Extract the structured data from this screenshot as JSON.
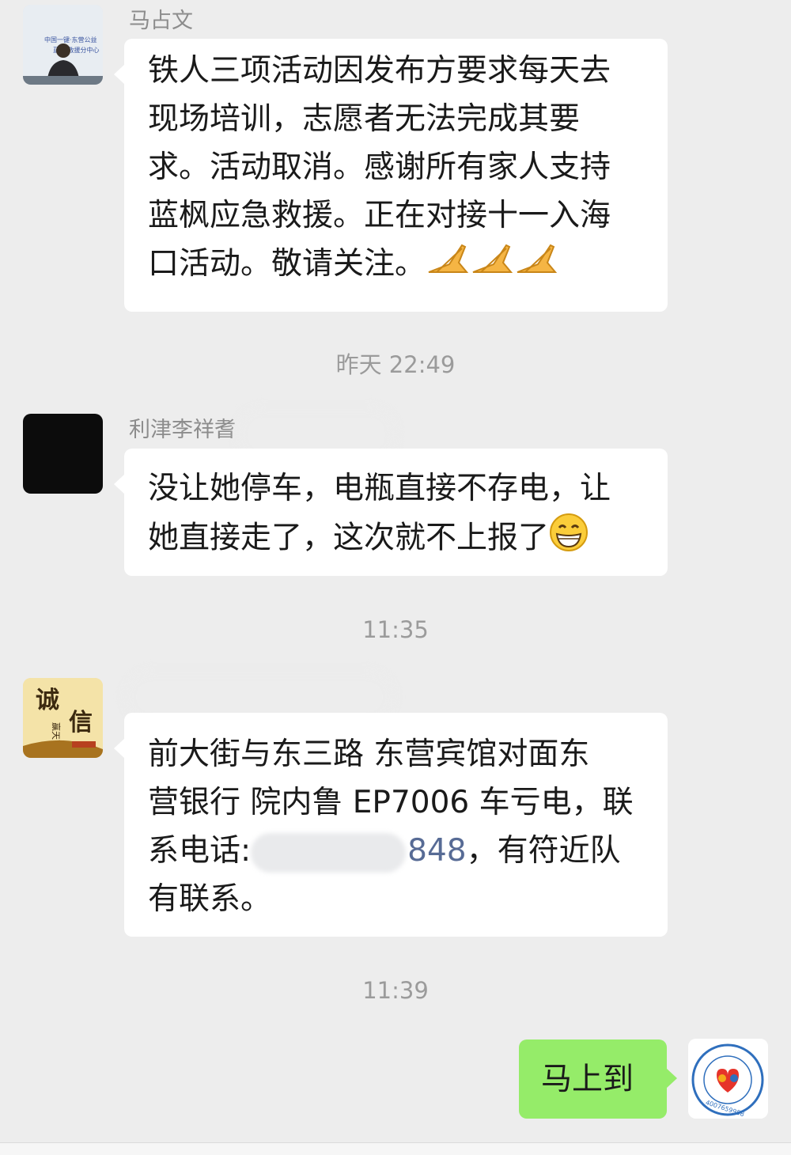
{
  "messages": [
    {
      "sender": "马占文",
      "lines": [
        "铁人三项活动因发布方要求每天去",
        "现场培训，志愿者无法完成其要",
        "求。活动取消。感谢所有家人支持",
        "蓝枫应急救援。正在对接十一入海",
        "口活动。敬请关注。"
      ],
      "avatar_text": [
        "中国一键·东营公益",
        "蓝枫 救援分中心"
      ]
    },
    {
      "sender": "利津李祥耆",
      "lines": [
        "没让她停车，电瓶直接不存电，让",
        "她直接走了，这次就不上报了"
      ]
    },
    {
      "sender": "",
      "lines": [
        "前大街与东三路 东营宾馆对面东",
        "营银行 院内鲁 EP7006 车亏电，联",
        "系电话:",
        "，有符近队",
        "有联系。"
      ],
      "phone_visible": "848",
      "avatar_text": [
        "诚",
        "信",
        "赢天下"
      ]
    },
    {
      "sender": "me",
      "lines": [
        "马上到"
      ],
      "avatar_text": "4007659958"
    }
  ],
  "times": [
    "昨天 22:49",
    "11:35",
    "11:39"
  ],
  "icons": {
    "praise": "praying-hands-emoji",
    "grin": "grinning-face-emoji"
  },
  "colors": {
    "background": "#ededed",
    "incoming_bubble": "#ffffff",
    "outgoing_bubble": "#95ec69",
    "time": "#9b9b9b",
    "link": "#576b95"
  }
}
